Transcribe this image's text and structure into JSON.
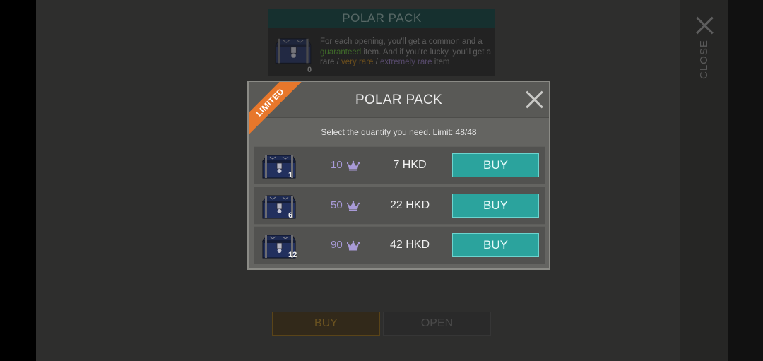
{
  "background": {
    "pack_title": "POLAR PACK",
    "chest_count": "0",
    "desc_part1": "For each opening, you'll get a common and a ",
    "desc_guaranteed": "guaranteed",
    "desc_part2": " item. And if you're lucky, you'll get a rare / ",
    "desc_very_rare": "very rare",
    "desc_sep": " / ",
    "desc_extremely_rare": "extremely rare",
    "desc_part3": " item",
    "close_label": "CLOSE",
    "buy_label": "BUY",
    "open_label": "OPEN"
  },
  "modal": {
    "ribbon": "LIMITED",
    "title": "POLAR PACK",
    "subtitle": "Select the quantity you need. Limit: 48/48",
    "options": [
      {
        "chests": "1",
        "crowns": "10",
        "price": "7 HKD",
        "button": "BUY"
      },
      {
        "chests": "6",
        "crowns": "50",
        "price": "22 HKD",
        "button": "BUY"
      },
      {
        "chests": "12",
        "crowns": "90",
        "price": "42 HKD",
        "button": "BUY"
      }
    ]
  },
  "icons": {
    "chest": "treasure-chest-icon",
    "crown": "crown-icon",
    "close": "close-icon"
  },
  "colors": {
    "buy_button": "#2ba39d",
    "ribbon": "#e7772b",
    "crown": "#a89ad8",
    "guaranteed": "#3f6a2a",
    "very_rare": "#6d4f1c",
    "extremely_rare": "#574a6c"
  }
}
